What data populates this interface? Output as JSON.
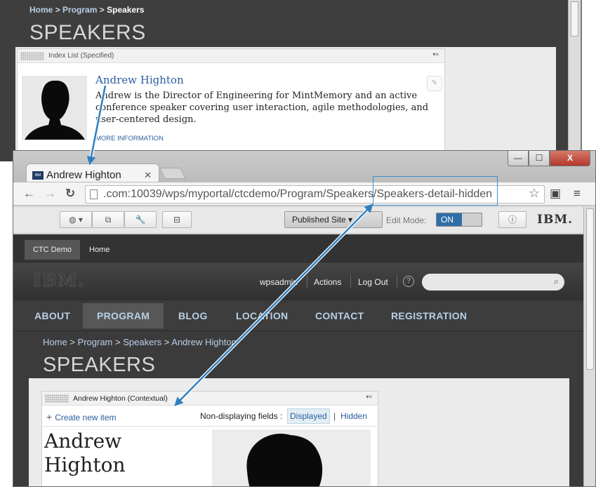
{
  "back": {
    "breadcrumb": [
      "Home",
      "Program",
      "Speakers"
    ],
    "breadcrumb_sep": ">",
    "page_title": "SPEAKERS",
    "portlet_title": "Index List (Specified)",
    "speaker_name": "Andrew Highton",
    "speaker_desc": "Andrew is the Director of Engineering for MintMemory and an active conference speaker covering user interaction, agile methodologies, and user-centered design.",
    "more_info": "MORE INFORMATION"
  },
  "browser": {
    "tab_title": "Andrew Highton",
    "favicon_text": "IBM",
    "url": ".com:10039/wps/myportal/ctcdemo/Program/Speakers/Speakers-detail-hidden",
    "window_controls": {
      "minimize": "—",
      "maximize": "☐",
      "close": "X"
    }
  },
  "wps_toolbar": {
    "site_select": "Published Site",
    "edit_mode_label": "Edit Mode:",
    "edit_mode_value": "ON",
    "brand": "IBM."
  },
  "site_nav": {
    "items": [
      "CTC Demo",
      "Home"
    ]
  },
  "masthead": {
    "logo": "IBM.",
    "user": "wpsadmin",
    "actions": "Actions",
    "logout": "Log Out",
    "help": "?"
  },
  "main_nav": {
    "items": [
      "ABOUT",
      "PROGRAM",
      "BLOG",
      "LOCATION",
      "CONTACT",
      "REGISTRATION"
    ],
    "active": "PROGRAM"
  },
  "front": {
    "breadcrumb": [
      "Home",
      "Program",
      "Speakers",
      "Andrew Highton"
    ],
    "breadcrumb_sep": ">",
    "page_title": "SPEAKERS",
    "portlet_title": "Andrew Highton (Contextual)",
    "create_item": "Create new item",
    "non_displaying_label": "Non-displaying fields :",
    "displayed": "Displayed",
    "pipe": "|",
    "hidden": "Hidden",
    "speaker_name": "Andrew Highton"
  },
  "colors": {
    "accent": "#2a5d9f",
    "arrow": "#2f7fbf",
    "dark_bg": "#3b3b3b"
  }
}
